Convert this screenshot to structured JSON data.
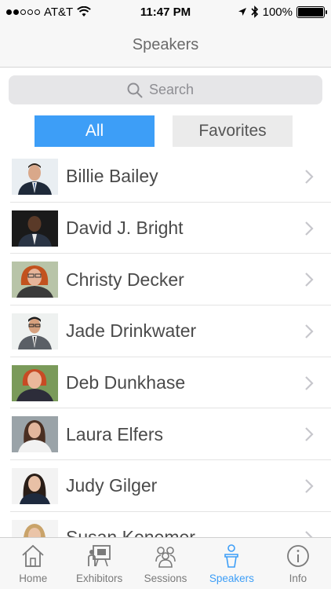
{
  "status": {
    "carrier": "AT&T",
    "time": "11:47 PM",
    "battery": "100%",
    "signal_bars_filled": 2
  },
  "nav": {
    "title": "Speakers"
  },
  "search": {
    "placeholder": "Search"
  },
  "segments": {
    "all": "All",
    "favorites": "Favorites",
    "selected": "All"
  },
  "speakers": [
    {
      "name": "Billie Bailey"
    },
    {
      "name": "David J. Bright"
    },
    {
      "name": "Christy Decker"
    },
    {
      "name": "Jade Drinkwater"
    },
    {
      "name": "Deb Dunkhase"
    },
    {
      "name": "Laura Elfers"
    },
    {
      "name": "Judy Gilger"
    },
    {
      "name": "Susan Kenemer"
    }
  ],
  "tabs": [
    {
      "label": "Home",
      "icon": "home-icon"
    },
    {
      "label": "Exhibitors",
      "icon": "exhibitors-icon"
    },
    {
      "label": "Sessions",
      "icon": "sessions-icon"
    },
    {
      "label": "Speakers",
      "icon": "speakers-icon"
    },
    {
      "label": "Info",
      "icon": "info-icon"
    }
  ],
  "colors": {
    "accent": "#3d9ef7",
    "segment_inactive": "#ebebeb",
    "bars": "#f7f7f7"
  }
}
